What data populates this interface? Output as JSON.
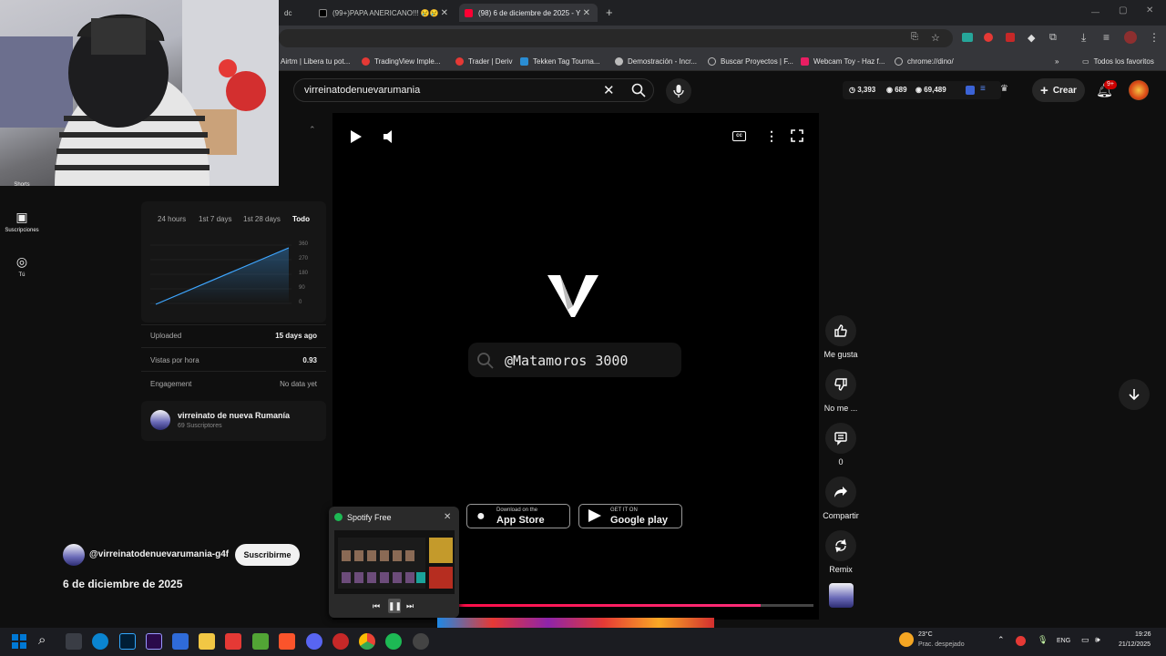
{
  "browser": {
    "tabs": [
      {
        "label": "dc",
        "active": false
      },
      {
        "label": "(99+)PAPA ANERICANO!!! 😢😢",
        "active": false
      },
      {
        "label": "(98) 6 de diciembre de 2025 - Y",
        "active": true
      }
    ],
    "new_tab_symbol": "+",
    "bookmarks": [
      "Airtm | Libera tu pot...",
      "TradingView Imple...",
      "Trader | Deriv",
      "Tekken Tag Tourna...",
      "Demostración - Incr...",
      "Buscar Proyectos | F...",
      "Webcam Toy - Haz f...",
      "chrome://dino/"
    ],
    "all_bookmarks": "Todos los favoritos"
  },
  "youtube": {
    "search_value": "virreinatodenuevarumania",
    "stats": {
      "views_a": "3,393",
      "views_b": "689",
      "views_c": "69,489"
    },
    "create_label": "Crear",
    "notifications_badge": "9+"
  },
  "sidebar": {
    "items": [
      {
        "label": "Shorts",
        "icon": "shorts-icon"
      },
      {
        "label": "Suscripciones",
        "icon": "subscriptions-icon"
      },
      {
        "label": "Tú",
        "icon": "you-icon"
      }
    ]
  },
  "analytics": {
    "ranges": [
      "24 hours",
      "1st 7 days",
      "1st 28 days",
      "Todo"
    ],
    "selected_range": "Todo",
    "y_ticks": [
      "360",
      "270",
      "180",
      "90",
      "0"
    ],
    "rows": [
      {
        "label": "Uploaded",
        "value": "15 days ago"
      },
      {
        "label": "Vistas por hora",
        "value": "0.93"
      },
      {
        "label": "Engagement",
        "value": "No data yet"
      }
    ],
    "channel_name": "virreinato de nueva Rumanía",
    "channel_subs": "69 Suscriptores"
  },
  "video": {
    "overlay_search_text": "@Matamoros 3000",
    "app_store_small": "Download on the",
    "app_store_big": "App Store",
    "google_small": "GET IT ON",
    "google_big": "Google play"
  },
  "channel": {
    "handle": "@virreinatodenuevarumania-g4f",
    "subscribe_label": "Suscribirme",
    "title": "6 de diciembre de 2025"
  },
  "actions": [
    {
      "label": "Me gusta",
      "icon": "thumbs-up-icon"
    },
    {
      "label": "No me ...",
      "icon": "thumbs-down-icon"
    },
    {
      "label": "0",
      "icon": "comment-icon"
    },
    {
      "label": "Compartir",
      "icon": "share-icon"
    },
    {
      "label": "Remix",
      "icon": "remix-icon"
    }
  ],
  "spotify": {
    "title": "Spotify Free"
  },
  "taskbar": {
    "weather_temp": "23°C",
    "weather_desc": "Prac. despejado",
    "language": "ENG",
    "time": "19:26",
    "date": "21/12/2025"
  },
  "colors": {
    "accent_red": "#ff0033",
    "chart_line": "#3ea6ff",
    "spotify_green": "#1db954"
  }
}
